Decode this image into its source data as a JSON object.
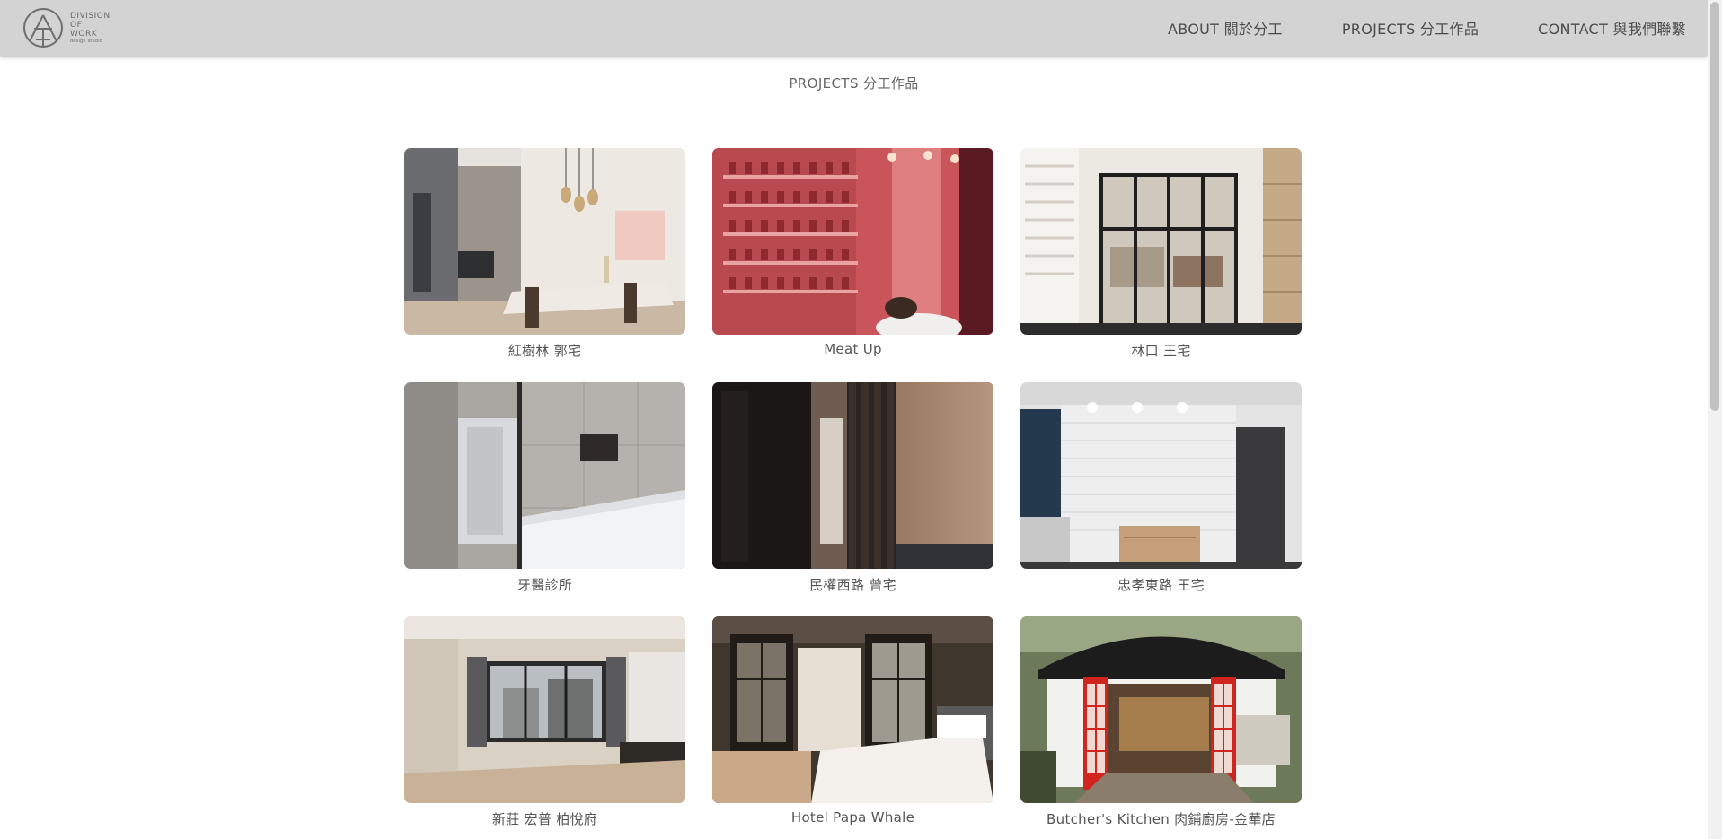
{
  "brand": {
    "logo_lines": [
      "DIVISION",
      "OF",
      "WORK"
    ],
    "logo_sub": "design studio"
  },
  "nav": {
    "about": "ABOUT 關於分工",
    "projects": "PROJECTS 分工作品",
    "contact": "CONTACT 與我們聯繫"
  },
  "page_title": "PROJECTS 分工作品",
  "projects": [
    {
      "title": "紅樹林 郭宅"
    },
    {
      "title": "Meat Up"
    },
    {
      "title": "林口 王宅"
    },
    {
      "title": "牙醫診所"
    },
    {
      "title": "民權西路 曾宅"
    },
    {
      "title": "忠孝東路 王宅"
    },
    {
      "title": "新莊 宏普 柏悅府"
    },
    {
      "title": "Hotel Papa Whale"
    },
    {
      "title": "Butcher's Kitchen 肉鋪廚房-金華店"
    }
  ]
}
